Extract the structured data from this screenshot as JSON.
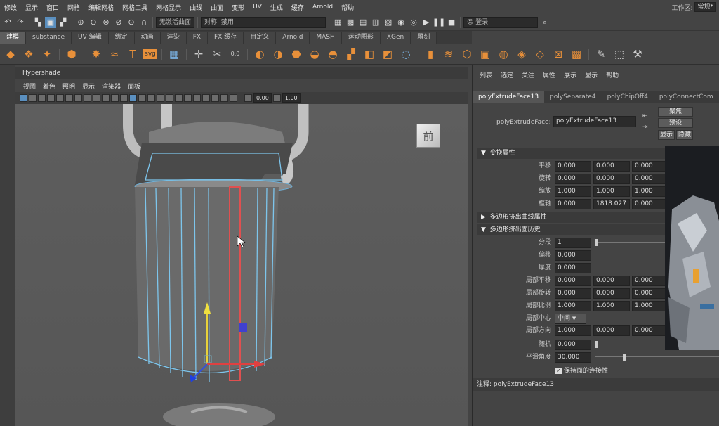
{
  "menubar": {
    "items": [
      "修改",
      "显示",
      "窗口",
      "网格",
      "编辑网格",
      "网格工具",
      "网格显示",
      "曲线",
      "曲面",
      "变形",
      "UV",
      "生成",
      "缓存",
      "Arnold",
      "帮助"
    ],
    "workspace_label": "工作区:",
    "workspace_value": "常规*"
  },
  "statusline": {
    "live_surface": "无激活曲面",
    "symmetry": "对称: 禁用",
    "login": "登录"
  },
  "shelf": {
    "tabs": [
      "建模",
      "substance",
      "UV 编辑",
      "绑定",
      "动画",
      "渲染",
      "FX",
      "FX 缓存",
      "自定义",
      "Arnold",
      "MASH",
      "运动图形",
      "XGen",
      "雕刻"
    ],
    "active_tab": 0
  },
  "hypershade": {
    "title": "Hypershade"
  },
  "viewport": {
    "menu": [
      "视图",
      "着色",
      "照明",
      "显示",
      "渲染器",
      "面板"
    ],
    "exposure": "0.00",
    "gamma": "1.00",
    "view_cube_label": "前"
  },
  "attr_editor": {
    "menu": [
      "列表",
      "选定",
      "关注",
      "属性",
      "展示",
      "显示",
      "帮助"
    ],
    "tabs": [
      "polyExtrudeFace13",
      "polySeparate4",
      "polyChipOff4",
      "polyConnectCom"
    ],
    "node_label": "polyExtrudeFace:",
    "node_value": "polyExtrudeFace13",
    "buttons": {
      "focus": "聚焦",
      "presets": "预设",
      "show": "显示",
      "hide": "隐藏"
    },
    "sections": {
      "transform": "变换属性",
      "curve": "多边形挤出曲线属性",
      "history": "多边形挤出面历史"
    },
    "transform_rows": [
      {
        "label": "平移",
        "values": [
          "0.000",
          "0.000",
          "0.000"
        ]
      },
      {
        "label": "旋转",
        "values": [
          "0.000",
          "0.000",
          "0.000"
        ]
      },
      {
        "label": "缩放",
        "values": [
          "1.000",
          "1.000",
          "1.000"
        ]
      },
      {
        "label": "枢轴",
        "values": [
          "0.000",
          "1818.027",
          "0.000"
        ]
      }
    ],
    "divisions": {
      "label": "分段",
      "value": "1"
    },
    "offset": {
      "label": "偏移",
      "value": "0.000"
    },
    "thickness": {
      "label": "厚度",
      "value": "0.000"
    },
    "local_rows": [
      {
        "label": "局部平移",
        "values": [
          "0.000",
          "0.000",
          "0.000"
        ]
      },
      {
        "label": "局部旋转",
        "values": [
          "0.000",
          "0.000",
          "0.000"
        ]
      },
      {
        "label": "局部比例",
        "values": [
          "1.000",
          "1.000",
          "1.000"
        ]
      }
    ],
    "local_center": {
      "label": "局部中心",
      "value": "中间"
    },
    "local_direction": {
      "label": "局部方向",
      "values": [
        "1.000",
        "0.000",
        "0.000"
      ]
    },
    "random": {
      "label": "随机",
      "value": "0.000"
    },
    "smoothing_angle": {
      "label": "平滑角度",
      "value": "30.000"
    },
    "keep_faces": "保持面的连接性",
    "notes": "注释: polyExtrudeFace13"
  }
}
